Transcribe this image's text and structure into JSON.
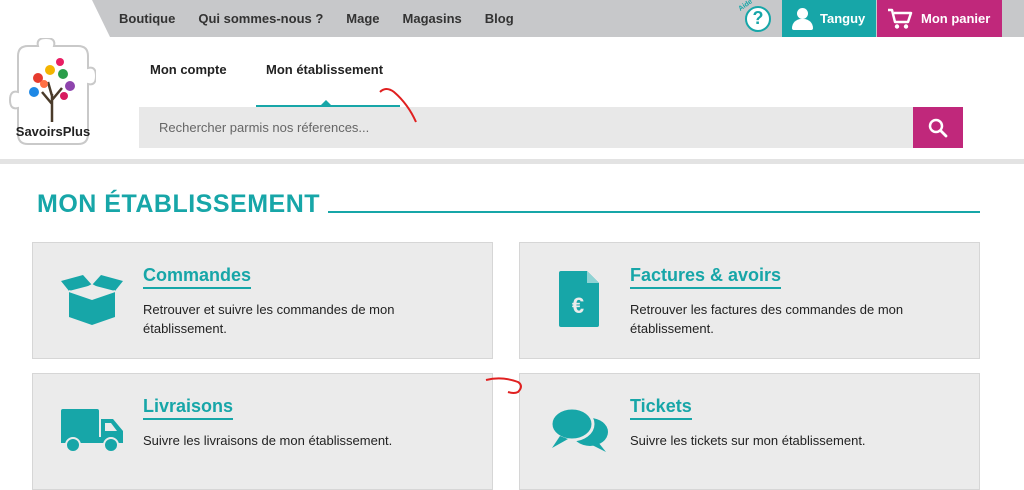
{
  "topnav": {
    "items": [
      "Boutique",
      "Qui sommes-nous ?",
      "Mage",
      "Magasins",
      "Blog"
    ]
  },
  "help": {
    "symbol": "?",
    "tag": "Aide"
  },
  "user": {
    "name": "Tanguy"
  },
  "cart": {
    "label": "Mon panier"
  },
  "logo": {
    "text": "SavoirsPlus"
  },
  "subnav": {
    "tabs": [
      {
        "label": "Mon compte",
        "active": false
      },
      {
        "label": "Mon établissement",
        "active": true
      }
    ]
  },
  "search": {
    "placeholder": "Rechercher parmis nos réferences..."
  },
  "page": {
    "title": "MON ÉTABLISSEMENT"
  },
  "cards": [
    {
      "title": "Commandes",
      "description": "Retrouver et suivre les commandes de mon établissement.",
      "icon": "box-icon"
    },
    {
      "title": "Factures & avoirs",
      "description": "Retrouver les factures des commandes de mon établissement.",
      "icon": "invoice-euro-icon"
    },
    {
      "title": "Livraisons",
      "description": "Suivre les livraisons de mon établissement.",
      "icon": "truck-icon"
    },
    {
      "title": "Tickets",
      "description": "Suivre les tickets sur mon établissement.",
      "icon": "chat-bubbles-icon"
    }
  ],
  "colors": {
    "accent": "#17a6a8",
    "brand": "#c0287b",
    "topbar": "#c7c8ca",
    "card": "#ebebeb"
  }
}
